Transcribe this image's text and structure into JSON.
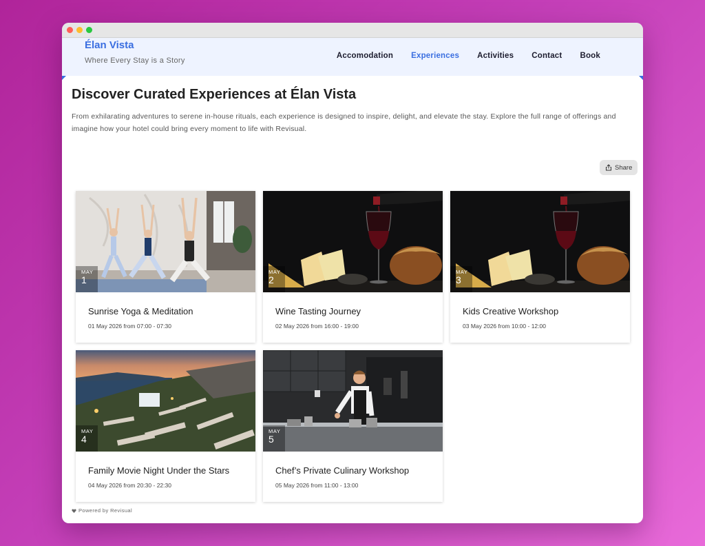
{
  "header": {
    "brand_title": "Élan Vista",
    "brand_tagline": "Where Every Stay is a Story",
    "nav": [
      "Accomodation",
      "Experiences",
      "Activities",
      "Contact",
      "Book"
    ],
    "active_nav": "Experiences"
  },
  "main": {
    "title": "Discover Curated Experiences at Élan Vista",
    "intro": "From exhilarating adventures to serene in-house rituals, each experience is designed to inspire, delight, and elevate the stay. Explore the full range of offerings and imagine how your hotel could bring every moment to life with Revisual.",
    "share_label": "Share"
  },
  "experiences": [
    {
      "title": "Sunrise Yoga & Meditation",
      "month": "MAY",
      "day": "1",
      "time": "01 May 2026 from 07:00 - 07:30",
      "image": "yoga-photo"
    },
    {
      "title": "Wine Tasting Journey",
      "month": "MAY",
      "day": "2",
      "time": "02 May 2026 from 16:00 - 19:00",
      "image": "wine-cheese-photo"
    },
    {
      "title": "Kids Creative Workshop",
      "month": "MAY",
      "day": "3",
      "time": "03 May 2026 from 10:00 - 12:00",
      "image": "wine-cheese-photo"
    },
    {
      "title": "Family Movie Night Under the Stars",
      "month": "MAY",
      "day": "4",
      "time": "04 May 2026 from 20:30 - 22:30",
      "image": "outdoor-cinema-photo"
    },
    {
      "title": "Chef’s Private Culinary Workshop",
      "month": "MAY",
      "day": "5",
      "time": "05 May 2026 from 11:00 - 13:00",
      "image": "chef-kitchen-photo"
    }
  ],
  "footer": {
    "powered_by": "Powered by Revisual"
  },
  "colors": {
    "accent": "#3a6ee0",
    "header_bg": "#eef3ff",
    "background": "#c43fb8"
  }
}
